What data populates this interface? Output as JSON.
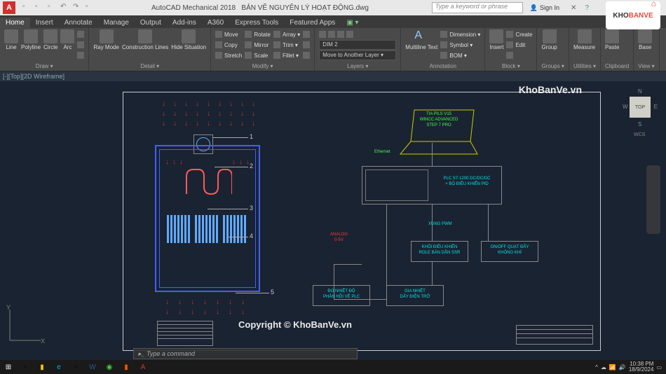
{
  "titlebar": {
    "app_letter": "A",
    "app_name": "AutoCAD Mechanical 2018",
    "filename": "BẢN VẼ NGUYÊN LÝ HOẠT ĐỘNG.dwg",
    "search_placeholder": "Type a keyword or phrase",
    "signin": "Sign In"
  },
  "ribbon_tabs": [
    "Home",
    "Insert",
    "Annotate",
    "Manage",
    "Output",
    "Add-ins",
    "A360",
    "Express Tools",
    "Featured Apps"
  ],
  "active_tab": "Home",
  "panels": {
    "draw": {
      "label": "Draw ▾",
      "buttons": [
        "Line",
        "Polyline",
        "Circle",
        "Arc"
      ]
    },
    "detail": {
      "label": "Detail ▾",
      "buttons": [
        "Ray Mode",
        "Construction Lines",
        "Hide Situation"
      ]
    },
    "modify": {
      "label": "Modify ▾",
      "rows": [
        [
          "Move",
          "Rotate",
          "Array ▾"
        ],
        [
          "Copy",
          "Mirror",
          "Trim ▾"
        ],
        [
          "Stretch",
          "Scale",
          "Fillet ▾"
        ]
      ]
    },
    "layers": {
      "label": "Layers ▾",
      "combo1": "DIM 2",
      "combo2": "Move to Another Layer ▾"
    },
    "annotation": {
      "label": "Annotation",
      "big": "Multiline Text",
      "items": [
        "Dimension ▾",
        "Symbol ▾",
        "BOM ▾"
      ]
    },
    "block": {
      "label": "Block ▾",
      "big": "Insert",
      "items": [
        "Create",
        "Edit"
      ]
    },
    "groups": {
      "label": "Groups ▾",
      "big": "Group"
    },
    "utilities": {
      "label": "Utilities ▾",
      "big": "Measure"
    },
    "clipboard": {
      "label": "Clipboard",
      "big": "Paste"
    },
    "view": {
      "label": "View ▾",
      "big": "Base"
    }
  },
  "doc_tab": "[-][Top][2D Wireframe]",
  "viewcube": {
    "top": "TOP",
    "n": "N",
    "s": "S",
    "e": "E",
    "w": "W",
    "wcs": "WCS"
  },
  "watermarks": {
    "top": "KhoBanVe.vn",
    "center": "Copyright © KhoBanVe.vn"
  },
  "logo": {
    "part1": "KHO",
    "part2": "BANVE"
  },
  "drawing": {
    "callouts": [
      "1",
      "2",
      "3",
      "4",
      "5"
    ],
    "laptop_screen": "TIA PILS V15\nWINCC ADVANCED\nSTEP 7 PRO",
    "ethernet": "Ethernet",
    "plc_label": "PLC S7-1200 DC/DC/DC\n+ BỘ ĐIỀU KHIỂN PID",
    "xung_pwm": "XUNG PWM",
    "analog": "ANALOG\n0-5V",
    "ssr": "KHỐI ĐIỀU KHIỂN\nROLE BÁN DẪN SSR",
    "fan_ctrl": "ON/OFF QUẠT ĐẨY\nKHÔNG KHÍ",
    "temp_fb": "ĐO NHIỆT ĐỘ\nPHẢN HỒI VỀ PLC",
    "heater": "GIA NHIỆT\nDÂY ĐIỆN TRỞ"
  },
  "ucs": {
    "x": "X",
    "y": "Y"
  },
  "cmdline_placeholder": "Type a command",
  "taskbar": {
    "time": "10:38 PM",
    "date": "18/9/2024"
  }
}
